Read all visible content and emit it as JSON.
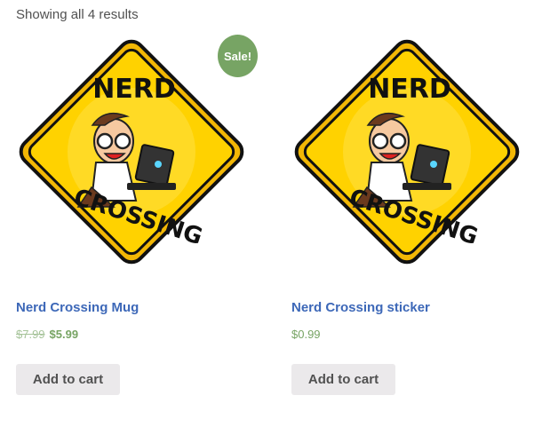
{
  "result_count": "Showing all 4 results",
  "colors": {
    "link": "#3d68b8",
    "price": "#77a464",
    "sale_badge": "#77a464",
    "button_bg": "#ebe9eb",
    "sign_yellow": "#ffd200"
  },
  "logo_text": {
    "top": "NERD",
    "bottom": "CROSSING"
  },
  "products": [
    {
      "name": "Nerd Crossing Mug",
      "on_sale": true,
      "sale_label": "Sale!",
      "regular_price": "$7.99",
      "sale_price": "$5.99",
      "button_label": "Add to cart"
    },
    {
      "name": "Nerd Crossing sticker",
      "on_sale": false,
      "price": "$0.99",
      "button_label": "Add to cart"
    }
  ]
}
